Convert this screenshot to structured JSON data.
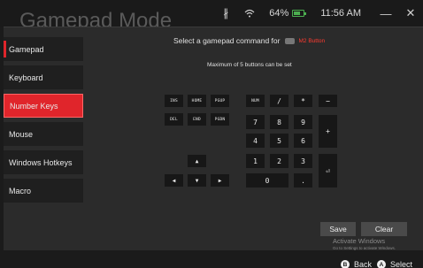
{
  "window": {
    "app_title": "Gamepad Mode",
    "bluetooth_icon": "bluetooth-icon",
    "wifi_icon": "wifi-icon",
    "battery_percent": "64%",
    "battery_icon": "battery-icon",
    "time": "11:56 AM",
    "minimize": "—",
    "close": "✕"
  },
  "sidebar": {
    "items": [
      {
        "label": "Gamepad"
      },
      {
        "label": "Keyboard"
      },
      {
        "label": "Number Keys"
      },
      {
        "label": "Mouse"
      },
      {
        "label": "Windows Hotkeys"
      },
      {
        "label": "Macro"
      }
    ],
    "active_index": 2,
    "accent_color": "#e0252b"
  },
  "main": {
    "heading": "Select a gamepad command for",
    "heading_button": "M2 Button",
    "subheading": "Maximum of 5 buttons can be set",
    "nav_keys": [
      "INS",
      "HOME",
      "PGUP",
      "DEL",
      "END",
      "PGDN"
    ],
    "arrow_keys": [
      "▲",
      "◀",
      "▼",
      "▶"
    ],
    "numpad_keys": [
      "NUM",
      "/",
      "*",
      "−",
      "7",
      "8",
      "9",
      "+",
      "4",
      "5",
      "6",
      "1",
      "2",
      "3",
      "⏎",
      "0",
      "."
    ],
    "save_label": "Save",
    "clear_label": "Clear"
  },
  "watermark": {
    "line1": "Activate Windows",
    "line2": "Go to Settings to activate Windows."
  },
  "footer": {
    "back_key": "B",
    "back_label": "Back",
    "select_key": "A",
    "select_label": "Select"
  }
}
